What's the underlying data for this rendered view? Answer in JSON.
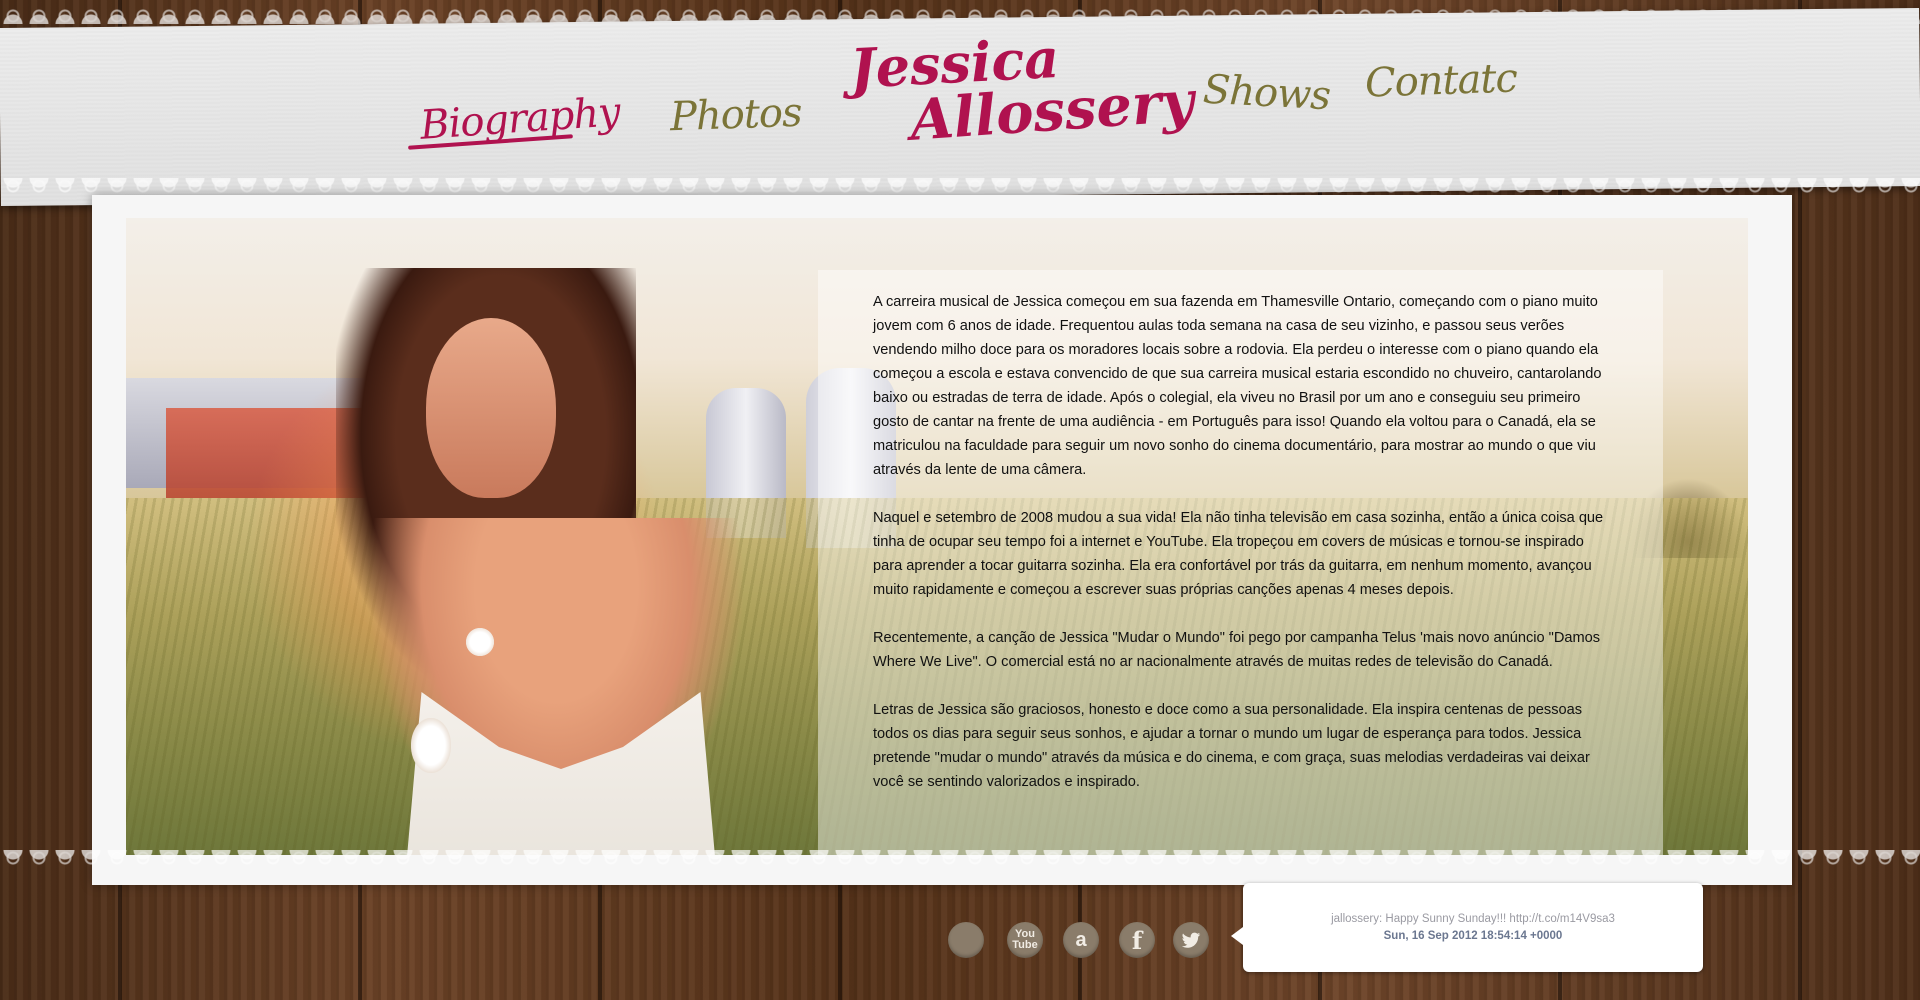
{
  "brand": {
    "line1": "Jessica",
    "line2": "Allossery",
    "color": "#b0124f"
  },
  "nav": {
    "biography": "Biography",
    "photos": "Photos",
    "shows": "Shows",
    "contact": "Contatc",
    "active_color": "#b0124f",
    "link_color": "#7b7438"
  },
  "content": {
    "paragraphs": [
      "A carreira musical de Jessica começou em sua fazenda em Thamesville Ontario, começando com o piano muito jovem com 6 anos de idade. Frequentou aulas toda semana na casa de seu vizinho, e passou seus verões vendendo milho doce para os moradores locais sobre a rodovia. Ela perdeu o interesse com o piano quando ela começou a escola e estava convencido de que sua carreira musical estaria escondido no chuveiro, cantarolando baixo ou estradas de terra de idade. Após o colegial, ela viveu no Brasil por um ano e conseguiu seu primeiro gosto de cantar na frente de uma audiência - em Português para isso! Quando ela voltou para o Canadá, ela se matriculou na faculdade para seguir um novo sonho do cinema documentário, para mostrar ao mundo o que viu através da lente de uma câmera.",
      "Naquel e setembro de 2008 mudou a sua vida! Ela não tinha televisão em casa sozinha, então a única coisa que tinha de ocupar seu tempo foi a internet e YouTube. Ela tropeçou em covers de músicas e tornou-se inspirado para aprender a tocar guitarra sozinha. Ela era confortável por trás da guitarra, em nenhum momento, avançou muito rapidamente e começou a escrever suas próprias canções apenas 4 meses depois.",
      "Recentemente, a canção de Jessica \"Mudar o Mundo\" foi pego por campanha Telus 'mais novo anúncio \"Damos Where We Live\". O comercial está no ar nacionalmente através de muitas redes de televisão do Canadá.",
      "Letras de Jessica são graciosos, honesto e doce como a sua personalidade. Ela inspira centenas de pessoas todos os dias para seguir seus sonhos, e ajudar a tornar o mundo um lugar de esperança para todos. Jessica pretende \"mudar o mundo\" através da música e do cinema, e com graça, suas melodias verdadeiras vai deixar você se sentindo valorizados e inspirado."
    ]
  },
  "social": {
    "youtube_label": "You\nTube",
    "amazon_label": "a",
    "facebook_label": "f",
    "icons": [
      "myspace-icon",
      "youtube-icon",
      "amazon-icon",
      "facebook-icon",
      "twitter-icon"
    ]
  },
  "tweet": {
    "text": "jallossery: Happy Sunny Sunday!!! http://t.co/m14V9sa3",
    "time": "Sun, 16 Sep 2012 18:54:14 +0000"
  }
}
